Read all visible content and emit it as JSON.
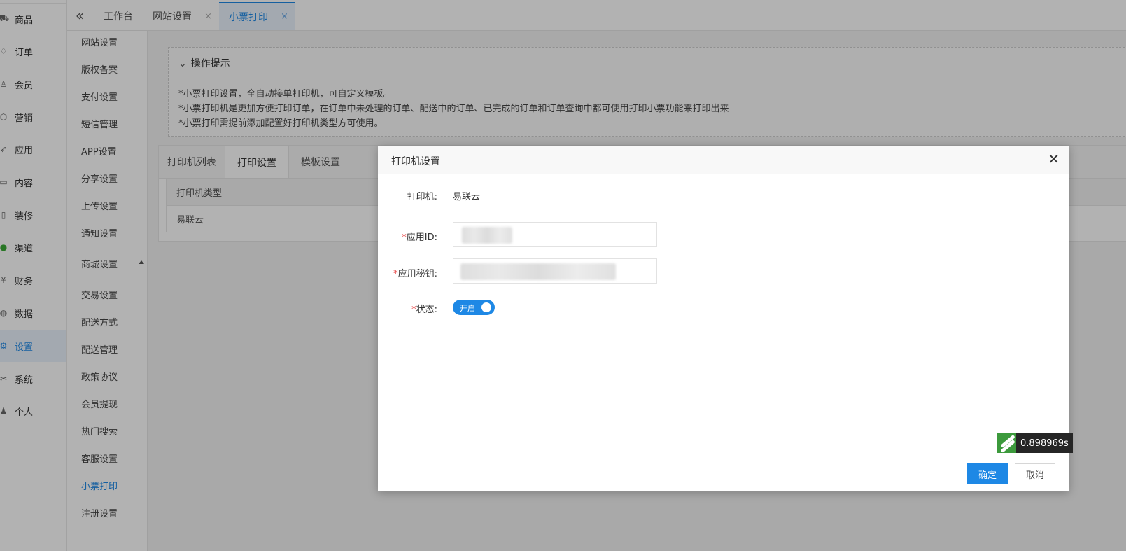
{
  "left_nav": {
    "items": [
      {
        "label": "商品",
        "icon": "cart-icon",
        "glyph": "⛟"
      },
      {
        "label": "订单",
        "icon": "bell-icon",
        "glyph": "♢"
      },
      {
        "label": "会员",
        "icon": "user-icon",
        "glyph": "♙"
      },
      {
        "label": "营销",
        "icon": "box-icon",
        "glyph": "⬡"
      },
      {
        "label": "应用",
        "icon": "send-icon",
        "glyph": "➶"
      },
      {
        "label": "内容",
        "icon": "book-icon",
        "glyph": "▭"
      },
      {
        "label": "装修",
        "icon": "phone-icon",
        "glyph": "▯"
      },
      {
        "label": "渠道",
        "icon": "wechat-icon",
        "glyph": "●"
      },
      {
        "label": "财务",
        "icon": "yen-icon",
        "glyph": "¥"
      },
      {
        "label": "数据",
        "icon": "globe-icon",
        "glyph": "◍"
      },
      {
        "label": "设置",
        "icon": "gear-icon",
        "glyph": "⚙"
      },
      {
        "label": "系统",
        "icon": "tools-icon",
        "glyph": "✂"
      },
      {
        "label": "个人",
        "icon": "person-icon",
        "glyph": "♟"
      }
    ],
    "active": "设置"
  },
  "sub_nav": {
    "items": [
      "网站设置",
      "版权备案",
      "支付设置",
      "短信管理",
      "APP设置",
      "分享设置",
      "上传设置",
      "通知设置",
      "商城设置",
      "交易设置",
      "配送方式",
      "配送管理",
      "政策协议",
      "会员提现",
      "热门搜索",
      "客服设置",
      "小票打印",
      "注册设置"
    ],
    "active": "小票打印"
  },
  "tabs": {
    "items": [
      {
        "label": "工作台",
        "closable": false
      },
      {
        "label": "网站设置",
        "closable": true
      },
      {
        "label": "小票打印",
        "closable": true
      }
    ],
    "close_glyph": "×",
    "collapse_glyph": "«"
  },
  "tips": {
    "title": "操作提示",
    "lines": [
      "*小票打印设置，全自动接单打印机，可自定义模板。",
      "*小票打印机是更加方便打印订单，在订单中未处理的订单、配送中的订单、已完成的订单和订单查询中都可使用打印小票功能来打印出来",
      "*小票打印需提前添加配置好打印机类型方可使用。"
    ]
  },
  "panel": {
    "tabs": [
      "打印机列表",
      "打印设置",
      "模板设置"
    ],
    "active_tab": "打印设置",
    "table_header": "打印机类型",
    "table_rows": [
      "易联云"
    ]
  },
  "modal": {
    "title": "打印机设置",
    "close_glyph": "✕",
    "printer_label": "打印机:",
    "printer_value": "易联云",
    "app_id_label": "应用ID:",
    "app_secret_label": "应用秘钥:",
    "status_label": "状态:",
    "required_mark": "*",
    "status_toggle": "开启",
    "status_on": true,
    "confirm": "确定",
    "cancel": "取消"
  },
  "timer": {
    "value": "0.898969s"
  },
  "colors": {
    "accent": "#1e88e5",
    "required": "#e84545"
  }
}
